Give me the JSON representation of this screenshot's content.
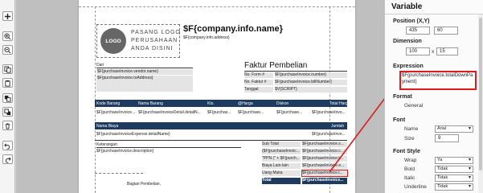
{
  "toolbar": {
    "icons": [
      "plus-icon",
      "zoom-in-icon",
      "zoom-out-icon",
      "copy-icon",
      "paste-icon",
      "bring-front-icon",
      "send-back-icon",
      "delete-icon",
      "undo-icon",
      "redo-icon"
    ]
  },
  "invoice": {
    "logo_badge": "LOGO",
    "logo_text": [
      "PASANG LOGO",
      "PERUSAHAAN",
      "ANDA DISINI"
    ],
    "company_name": "$F{company.info.name}",
    "company_address": "$F{company.info.address}",
    "from_label": "Dari",
    "vendor_name": "$F{purchaseInvoice.vendor.name}",
    "to_address": "$F{purchaseInvoice.toAddress}",
    "title": "Faktur Pembelian",
    "meta": [
      {
        "label": "No. Form #",
        "value": "$F{purchaseInvoice.number}"
      },
      {
        "label": "No. Faktur #",
        "value": "$F{purchaseInvoice.billNumber}"
      },
      {
        "label": "Tanggal",
        "value": "$V{SCRIPT}"
      }
    ],
    "item_headers": [
      "Kode Barang",
      "Nama Barang",
      "Kts.",
      "@Harga",
      "Diskon",
      "Total Harga"
    ],
    "item_row": [
      "$F{purchaseInvoice...",
      "$F{purchaseInvoiceDetail.detailN...",
      "$F{purchas...",
      "$F{purchase...",
      "$F{purchase...",
      "$F{purchaseInvo..."
    ],
    "expense_headers": [
      "Nama Biaya",
      "Jumlah"
    ],
    "expense_row": [
      "$F{purchaseInvoiceExpense.detailName}",
      "$F{purchaseInvo..."
    ],
    "notes_label": "Keterangan",
    "notes_value": "$F{purchaseInvoice.description}",
    "summary": [
      {
        "label": "Sub Total",
        "value": "$F{purchaseInvoice.s..."
      },
      {
        "label": "($F{purchaseInvoic...",
        "value": "$F{purchaseInvoice.c..."
      },
      {
        "label": "\"PPN (\" + $F{purch...",
        "value": "$F{purchaseInvoice.t..."
      },
      {
        "label": "Biaya Lain-lain",
        "value": "$F{purchaseInvoice.e..."
      },
      {
        "label": "Uang Muka",
        "value": "$F{purchaseInvoice.t..."
      },
      {
        "label": "Total",
        "value": "$F{purchaseInvoice..."
      }
    ],
    "signature": "Bagian Pembelian,"
  },
  "panel": {
    "header": "Variable",
    "position_label": "Position (X,Y)",
    "pos_x": "435",
    "pos_y": "60",
    "dimension_label": "Dimension",
    "dim_w": "100",
    "dim_sep": "x",
    "dim_h": "15",
    "expression_label": "Expression",
    "expression_value": "$F{purchaseInvoice.totalDownPayment}",
    "format_label": "Format",
    "format_value": "General",
    "font_label": "Font",
    "name_label": "Name",
    "name_value": "Arial",
    "size_label": "Size",
    "size_value": "9",
    "fontstyle_label": "Font Style",
    "wrap_label": "Wrap",
    "wrap_value": "Ya",
    "bold_label": "Bold",
    "bold_value": "Tidak",
    "italic_label": "Italic",
    "italic_value": "Tidak",
    "underline_label": "Underline",
    "underline_value": "Tidak"
  },
  "colors": {
    "annotation": "#e0191f",
    "header_bar": "#1f3a5f",
    "label_fill": "#e4e4e4"
  }
}
